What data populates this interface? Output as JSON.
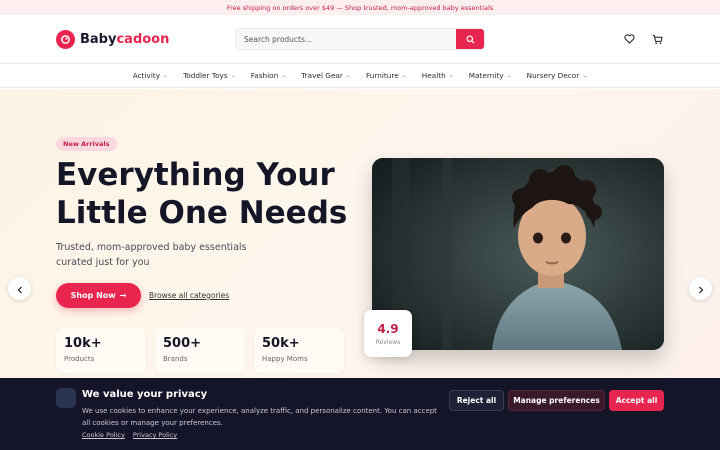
{
  "promo": {
    "text": "Free shipping on orders over $49 — Shop trusted, mom-approved baby essentials"
  },
  "brand": {
    "name_primary": "Baby",
    "name_accent": "cadoon",
    "accent_color": "#e8254e"
  },
  "search": {
    "placeholder": "Search products..."
  },
  "header_icons": [
    "heart-icon",
    "cart-icon"
  ],
  "nav": {
    "items": [
      {
        "label": "Activity"
      },
      {
        "label": "Toddler Toys"
      },
      {
        "label": "Fashion"
      },
      {
        "label": "Travel Gear"
      },
      {
        "label": "Furniture"
      },
      {
        "label": "Health"
      },
      {
        "label": "Maternity"
      },
      {
        "label": "Nursery Decor"
      }
    ]
  },
  "hero": {
    "badge": "New Arrivals",
    "headline": "Everything Your Little One Needs",
    "subtitle": "Trusted, mom-approved baby essentials curated just for you",
    "cta": "Shop Now",
    "browse": "Browse all categories",
    "stats": [
      {
        "value": "10k+",
        "label": "Products"
      },
      {
        "value": "500+",
        "label": "Brands"
      },
      {
        "value": "50k+",
        "label": "Happy Moms"
      }
    ],
    "rating": {
      "value": "4.9",
      "label": "Reviews"
    }
  },
  "cookie": {
    "title": "We value your privacy",
    "text": "We use cookies to enhance your experience, analyze traffic, and personalize content. You can accept all cookies or manage your preferences.",
    "links": {
      "policy": "Cookie Policy",
      "privacy": "Privacy Policy"
    },
    "buttons": {
      "reject": "Reject all",
      "manage": "Manage preferences",
      "accept": "Accept all"
    }
  }
}
